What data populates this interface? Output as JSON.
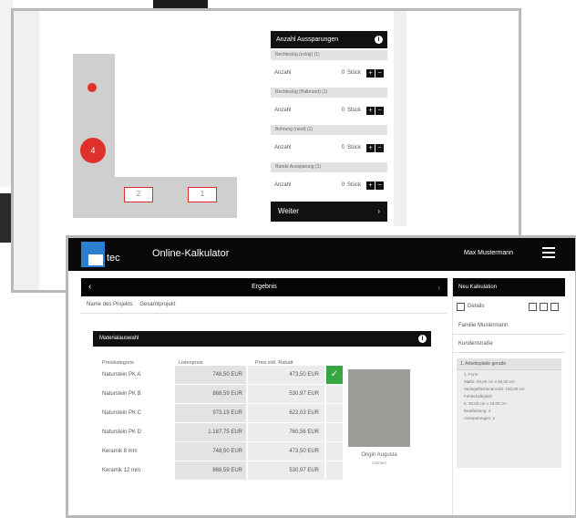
{
  "back_window": {
    "circle_label": "4",
    "rect_labels": [
      "2",
      "1"
    ],
    "panel": {
      "header": "Anzahl Aussparungen",
      "groups": [
        {
          "title": "Rechteckig (eckig) (1)",
          "label": "Anzahl",
          "value": "0",
          "unit": "Stück"
        },
        {
          "title": "Rechteckig (Halbrund) (1)",
          "label": "Anzahl",
          "value": "0",
          "unit": "Stück"
        },
        {
          "title": "Bohrung (rund) (1)",
          "label": "Anzahl",
          "value": "0",
          "unit": "Stück"
        },
        {
          "title": "Runde Aussparung (1)",
          "label": "Anzahl",
          "value": "0",
          "unit": "Stück"
        }
      ],
      "next_label": "Weiter"
    }
  },
  "front_window": {
    "logo_text": "tec",
    "app_title": "Online-Kalkulator",
    "user_name": "Max Mustermann",
    "result_bar": "Ergebnis",
    "project_labels": [
      "Name des Projekts",
      "Gesamtprojekt"
    ],
    "material_header": "Materialauswahl",
    "table_headers": [
      "Preiskategorie",
      "Listenpreis",
      "Preis inkl. Rabatt"
    ],
    "rows": [
      {
        "name": "Naturstein PK A",
        "list": "748,50 EUR",
        "price": "473,50 EUR",
        "selected": true
      },
      {
        "name": "Naturstein PK B",
        "list": "868,59 EUR",
        "price": "530,97 EUR",
        "selected": false
      },
      {
        "name": "Naturstein PK C",
        "list": "973,19 EUR",
        "price": "622,03 EUR",
        "selected": false
      },
      {
        "name": "Naturstein PK D",
        "list": "1.187,75 EUR",
        "price": "760,56 EUR",
        "selected": false
      },
      {
        "name": "Keramik 8 mm",
        "list": "748,50 EUR",
        "price": "473,50 EUR",
        "selected": false
      },
      {
        "name": "Keramik 12 mm",
        "list": "868,59 EUR",
        "price": "530,97 EUR",
        "selected": false
      }
    ],
    "sample_caption": "Origin Augusta",
    "sample_subcaption": "satiniert",
    "sidebar": {
      "header": "Neu Kalkulation",
      "tool_label": "Details",
      "customer_name": "Familie Mustermann",
      "customer_field": "Kundenstraße",
      "card_title": "1. Arbeitsplatte gerade",
      "card_lines": [
        "1. Form",
        "Maße: 90,00 cm x 60,00 cm",
        "Verlegeflächenanzahl: 150,00 cm",
        "Fehlerhaftigkeit",
        "6. 30,00 cm x 10,00 cm",
        "Bearbeitung: 4",
        "Aussparungen: 2"
      ]
    }
  }
}
